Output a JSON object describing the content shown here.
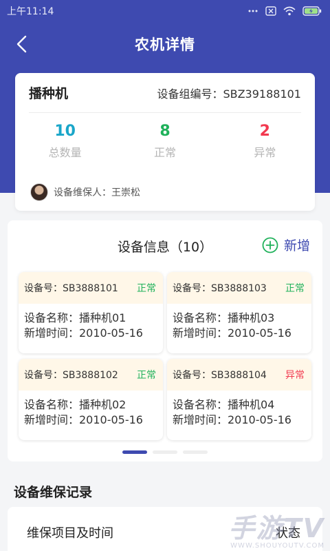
{
  "status_bar": {
    "time": "上午11:14",
    "signal": "...",
    "battery": "⚡"
  },
  "nav": {
    "title": "农机详情"
  },
  "summary": {
    "machine_name": "播种机",
    "group_no": "设备组编号：SBZ39188101",
    "stats": [
      {
        "value": "10",
        "label": "总数量",
        "color": "#1aa6c9"
      },
      {
        "value": "8",
        "label": "正常",
        "color": "#1fb15a"
      },
      {
        "value": "2",
        "label": "异常",
        "color": "#f2394f"
      }
    ],
    "keeper": "设备维保人：王崇松"
  },
  "devices": {
    "title": "设备信息（10）",
    "add_label": "新增",
    "items": [
      {
        "code": "设备号：SB3888101",
        "status": "正常",
        "status_color": "#1fb15a",
        "name": "设备名称：播种机01",
        "date": "新增时间：2010-05-16"
      },
      {
        "code": "设备号：SB3888103",
        "status": "正常",
        "status_color": "#1fb15a",
        "name": "设备名称：播种机03",
        "date": "新增时间：2010-05-16"
      },
      {
        "code": "设备号：SB3888102",
        "status": "正常",
        "status_color": "#1fb15a",
        "name": "设备名称：播种机02",
        "date": "新增时间：2010-05-16"
      },
      {
        "code": "设备号：SB3888104",
        "status": "异常",
        "status_color": "#f2394f",
        "name": "设备名称：播种机04",
        "date": "新增时间：2010-05-16"
      }
    ]
  },
  "records": {
    "title": "设备维保记录",
    "col_left": "维保项目及时间",
    "col_right": "状态"
  },
  "watermark": {
    "big": "手游TV",
    "small": "WWW.SHOUYOUTV.COM"
  },
  "colors": {
    "brand": "#3e4ab0",
    "card_top": "#fff7e8"
  }
}
